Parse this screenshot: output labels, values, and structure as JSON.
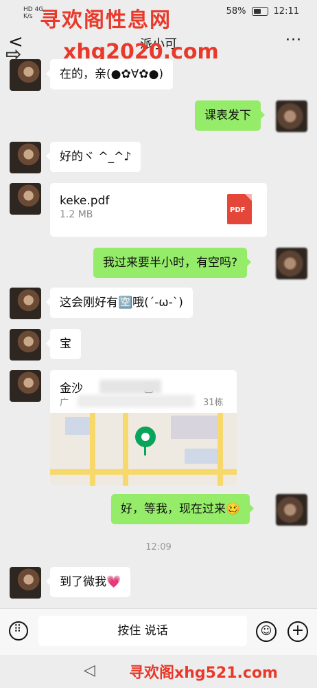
{
  "status": {
    "left_top": "HD 4G",
    "left_bottom": "K/s",
    "battery": "58%",
    "time": "12:11"
  },
  "watermark": {
    "top": "寻欢阁性息网",
    "middle": "xhg2020.com",
    "bottom": "寻欢阁xhg521.com"
  },
  "header": {
    "back": "<",
    "title": "派小可",
    "more": "···"
  },
  "messages": [
    {
      "side": "left",
      "text": "在的，亲(●✿∀✿●)"
    },
    {
      "side": "right",
      "text": "课表发下"
    },
    {
      "side": "left",
      "text": "好的ヾ ^_^♪"
    },
    {
      "side": "right",
      "text": "我过来要半小时，有空吗?"
    },
    {
      "side": "left",
      "text": "这会刚好有🈳哦(´-ω-`)"
    },
    {
      "side": "left",
      "text": "宝"
    },
    {
      "side": "right",
      "text": "好，等我，现在过来🥴"
    },
    {
      "side": "left",
      "text": "到了微我💗"
    }
  ],
  "file": {
    "name": "keke.pdf",
    "size": "1.2 MB",
    "icon": "PDF"
  },
  "location": {
    "title": "金沙",
    "title_tail": "也",
    "address_prefix": "广",
    "address_suffix": "31栋"
  },
  "timestamp": "12:09",
  "input": {
    "hold_to_talk": "按住 说话"
  },
  "icons": {
    "keyboard": "keyboard-icon",
    "emoji": "emoji-icon",
    "plus": "plus-icon",
    "back": "back-triangle-icon"
  }
}
